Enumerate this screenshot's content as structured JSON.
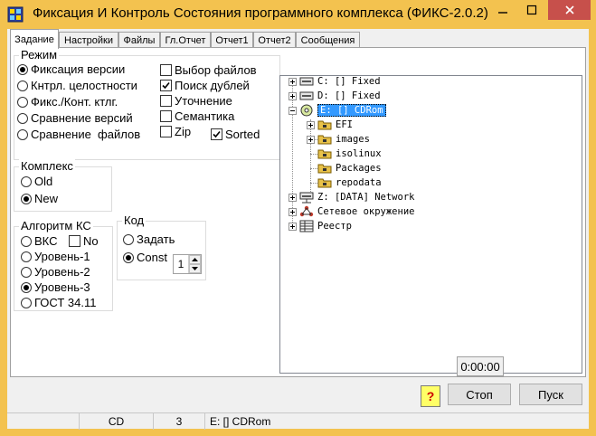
{
  "window": {
    "title": "Фиксация И Контроль Состояния программного комплекса (ФИКС-2.0.2)",
    "icons": {
      "app": "fiks-app-icon",
      "minimize": "minimize-icon",
      "maximize": "maximize-icon",
      "close": "close-icon"
    }
  },
  "tabs": [
    {
      "label": "Задание",
      "active": true
    },
    {
      "label": "Настройки",
      "active": false
    },
    {
      "label": "Файлы",
      "active": false
    },
    {
      "label": "Гл.Отчет",
      "active": false
    },
    {
      "label": "Отчет1",
      "active": false
    },
    {
      "label": "Отчет2",
      "active": false
    },
    {
      "label": "Сообщения",
      "active": false
    }
  ],
  "mode": {
    "title": "Режим",
    "radios": [
      {
        "label": "Фиксация версии",
        "checked": true
      },
      {
        "label": "Кнтрл. целостности",
        "checked": false
      },
      {
        "label": "Фикс./Конт. ктлг.",
        "checked": false
      },
      {
        "label": "Сравнение версий",
        "checked": false
      },
      {
        "label": "Сравнение  файлов",
        "checked": false
      }
    ],
    "checks": [
      {
        "label": "Выбор файлов",
        "checked": false
      },
      {
        "label": "Поиск дублей",
        "checked": true
      },
      {
        "label": "Уточнение",
        "checked": false
      },
      {
        "label": "Семантика",
        "checked": false
      },
      {
        "label": "Zip",
        "checked": false
      },
      {
        "label": "Sorted",
        "checked": true
      }
    ]
  },
  "complex": {
    "title": "Комплекс",
    "radios": [
      {
        "label": "Old",
        "checked": false
      },
      {
        "label": "New",
        "checked": true
      }
    ]
  },
  "algorithm": {
    "title": "Алгоритм КС",
    "radios": [
      {
        "label": "ВКС",
        "checked": false
      },
      {
        "label": "Уровень-1",
        "checked": false
      },
      {
        "label": "Уровень-2",
        "checked": false
      },
      {
        "label": "Уровень-3",
        "checked": true
      },
      {
        "label": "ГОСТ 34.11",
        "checked": false
      }
    ],
    "no_check": {
      "label": "No",
      "checked": false
    }
  },
  "code": {
    "title": "Код",
    "radios": [
      {
        "label": "Задать",
        "checked": false
      },
      {
        "label": "Const",
        "checked": true
      }
    ],
    "spin_value": "1"
  },
  "tree": {
    "nodes": [
      {
        "label": "C: [] Fixed",
        "icon": "drive-icon"
      },
      {
        "label": "D: [] Fixed",
        "icon": "drive-icon"
      },
      {
        "label": "E: [] CDRom",
        "icon": "cdrom-icon",
        "selected": true
      },
      {
        "label": "EFI",
        "icon": "folder-icon"
      },
      {
        "label": "images",
        "icon": "folder-icon"
      },
      {
        "label": "isolinux",
        "icon": "folder-icon"
      },
      {
        "label": "Packages",
        "icon": "folder-icon"
      },
      {
        "label": "repodata",
        "icon": "folder-icon"
      },
      {
        "label": "Z: [DATA] Network",
        "icon": "network-drive-icon"
      },
      {
        "label": "Сетевое окружение",
        "icon": "network-neighborhood-icon"
      },
      {
        "label": "Реестр",
        "icon": "registry-icon"
      }
    ]
  },
  "timer": "0:00:00",
  "buttons": {
    "help": "?",
    "stop": "Стоп",
    "start": "Пуск"
  },
  "status": {
    "drive_type": "CD",
    "count": "3",
    "path": "E: [] CDRom"
  },
  "colors": {
    "titlebar": "#f3c24f",
    "close_button": "#c7504b",
    "selection": "#3399ff",
    "folder": "#e8c24a"
  }
}
